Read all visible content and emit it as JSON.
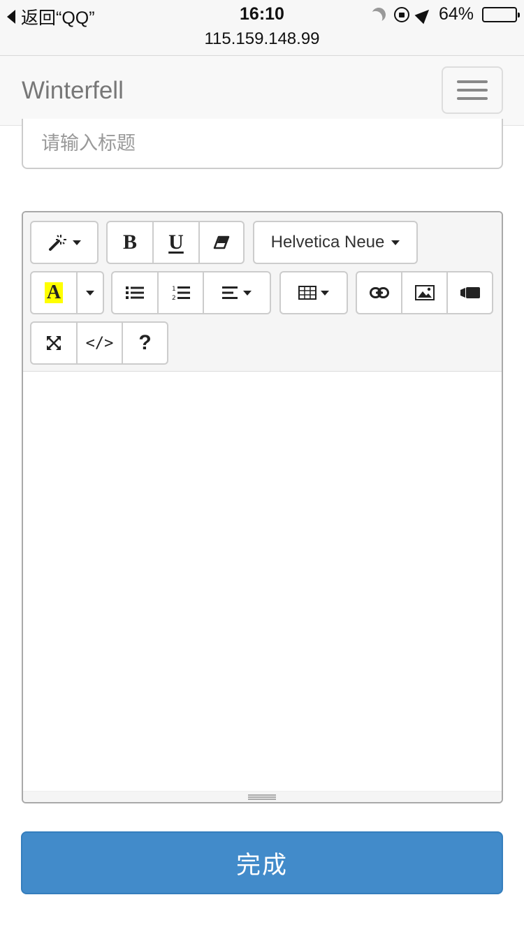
{
  "status_bar": {
    "back_label": "返回“QQ”",
    "time": "16:10",
    "url": "115.159.148.99",
    "battery_text": "64%",
    "battery_level": 0.64
  },
  "navbar": {
    "brand": "Winterfell"
  },
  "form": {
    "title_placeholder": "请输入标题",
    "title_value": ""
  },
  "editor": {
    "font_name": "Helvetica Neue",
    "bold_label": "B",
    "underline_label": "U",
    "forecolor_label": "A",
    "codeview_label": "</>",
    "help_label": "?",
    "content": ""
  },
  "actions": {
    "done_label": "完成"
  },
  "colors": {
    "primary": "#428bca",
    "highlight": "#ffff00"
  },
  "icons": [
    "wand-icon",
    "eraser-icon",
    "unordered-list-icon",
    "ordered-list-icon",
    "align-left-icon",
    "table-icon",
    "link-icon",
    "picture-icon",
    "video-icon",
    "fullscreen-icon",
    "menu-icon"
  ]
}
